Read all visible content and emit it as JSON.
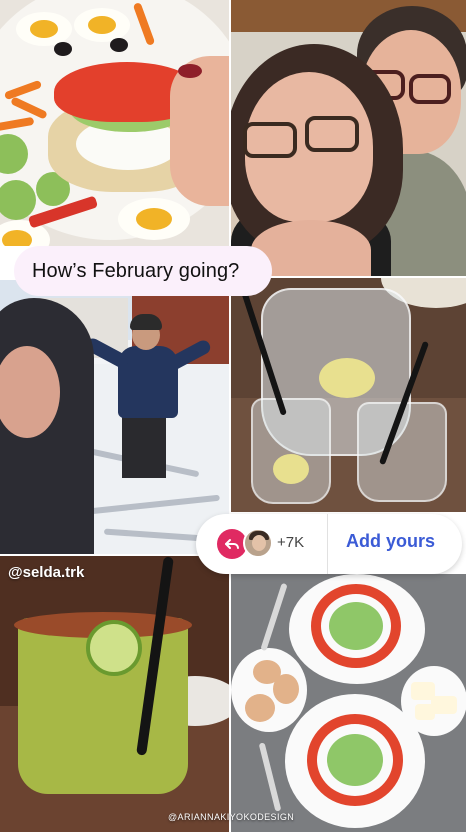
{
  "story": {
    "question": "How’s February going?",
    "username": "@selda.trk",
    "credit": "@ARIANNAKIYOKODESIGN"
  },
  "add_yours": {
    "participant_count": "+7K",
    "label": "Add yours",
    "accent_color": "#e02a62",
    "label_color": "#3b5bd6"
  },
  "photos": [
    {
      "name": "food-closeup-photo"
    },
    {
      "name": "couple-selfie-photo"
    },
    {
      "name": "snow-day-photo"
    },
    {
      "name": "pitcher-drink-photo"
    },
    {
      "name": "margarita-photo"
    },
    {
      "name": "vegetable-plates-photo"
    }
  ]
}
